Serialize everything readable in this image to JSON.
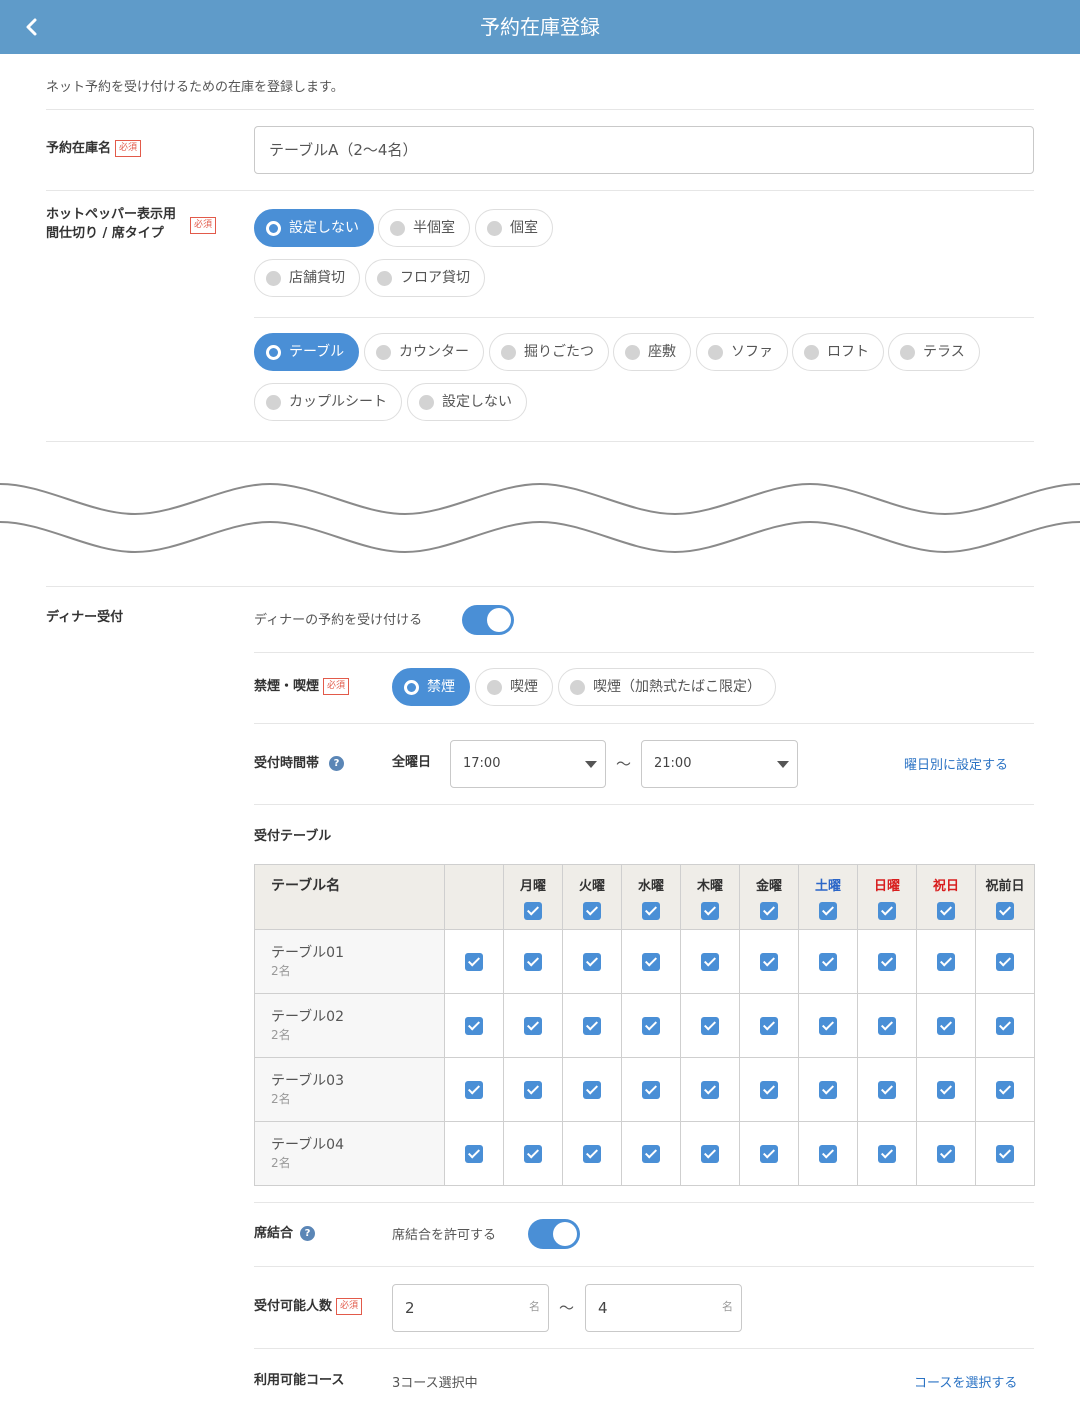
{
  "header": {
    "title": "予約在庫登録"
  },
  "intro": "ネット予約を受け付けるための在庫を登録します。",
  "required_label": "必須",
  "inventory_name": {
    "label": "予約在庫名",
    "value": "テーブルA（2〜4名）"
  },
  "hotpepper": {
    "label_line1": "ホットペッパー表示用",
    "label_line2": "間仕切り / 席タイプ",
    "partition_options": [
      "設定しない",
      "半個室",
      "個室",
      "店舗貸切",
      "フロア貸切"
    ],
    "seat_type_options": [
      "テーブル",
      "カウンター",
      "掘りごたつ",
      "座敷",
      "ソファ",
      "ロフト",
      "テラス",
      "カップルシート",
      "設定しない"
    ]
  },
  "dinner": {
    "label": "ディナー受付",
    "toggle_text": "ディナーの予約を受け付ける",
    "smoking": {
      "label": "禁煙・喫煙",
      "options": [
        "禁煙",
        "喫煙",
        "喫煙（加熱式たばこ限定）"
      ]
    },
    "hours": {
      "label": "受付時間帯",
      "help": "?",
      "day_label": "全曜日",
      "start": "17:00",
      "tilde": "〜",
      "end": "21:00",
      "link": "曜日別に設定する"
    },
    "tables": {
      "label": "受付テーブル",
      "name_header": "テーブル名",
      "days": [
        "月曜",
        "火曜",
        "水曜",
        "木曜",
        "金曜",
        "土曜",
        "日曜",
        "祝日",
        "祝前日"
      ],
      "rows": [
        {
          "name": "テーブル01",
          "capacity": "2名"
        },
        {
          "name": "テーブル02",
          "capacity": "2名"
        },
        {
          "name": "テーブル03",
          "capacity": "2名"
        },
        {
          "name": "テーブル04",
          "capacity": "2名"
        }
      ]
    },
    "combine": {
      "label": "席結合",
      "help": "?",
      "text": "席結合を許可する"
    },
    "party_size": {
      "label": "受付可能人数",
      "min": "2",
      "max": "4",
      "unit": "名",
      "tilde": "〜"
    },
    "courses": {
      "label": "利用可能コース",
      "value": "3コース選択中",
      "link": "コースを選択する"
    }
  }
}
